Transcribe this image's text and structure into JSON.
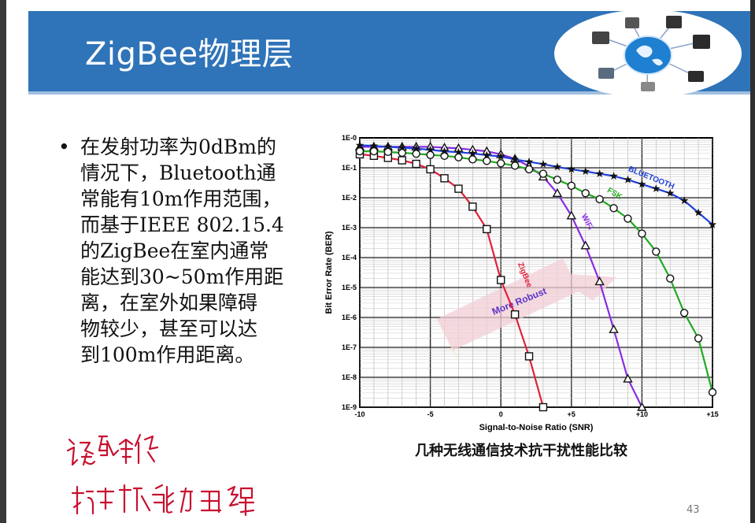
{
  "slide": {
    "title": "ZigBee物理层",
    "bullet_marker": "•",
    "bullet_text": "在发射功率为0dBm的\n情况下，Bluetooth通\n常能有10m作用范围，\n而基于IEEE 802.15.4\n的ZigBee在室内通常\n能达到30~50m作用距\n离，在室外如果障碍\n物较少，甚至可以达\n到100m作用距离。",
    "caption": "几种无线通信技术抗干扰性能比较",
    "page_number": "43",
    "logo_icon": "network-globe-icon",
    "handwriting_icon": "handwritten-annotation-icon",
    "colors": {
      "banner": "#2f73b8",
      "zigbee": "#e0203a",
      "wifi": "#8a2be2",
      "fsk": "#22aa22",
      "bluetooth": "#1f3fd8"
    }
  },
  "chart_data": {
    "type": "line",
    "xlabel": "Signal-to-Noise Ratio (SNR)",
    "ylabel": "Bit Error Rate (BER)",
    "xlim": [
      -10,
      15
    ],
    "ylim_log10": [
      -9,
      0
    ],
    "x_ticks": [
      "-10",
      "-5",
      "0",
      "+5",
      "+10",
      "+15"
    ],
    "x_tick_values": [
      -10,
      -5,
      0,
      5,
      10,
      15
    ],
    "y_ticks": [
      "1E-0",
      "1E-1",
      "1E-2",
      "1E-3",
      "1E-4",
      "1E-5",
      "1E-6",
      "1E-7",
      "1E-8",
      "1E-9"
    ],
    "y_tick_exponents": [
      0,
      -1,
      -2,
      -3,
      -4,
      -5,
      -6,
      -7,
      -8,
      -9
    ],
    "grid": true,
    "arrow_label": "More Robust",
    "series": [
      {
        "name": "ZigBee",
        "marker": "square",
        "color": "#e0203a",
        "points": [
          [
            -10,
            -0.55
          ],
          [
            -9,
            -0.6
          ],
          [
            -8,
            -0.67
          ],
          [
            -7,
            -0.75
          ],
          [
            -6,
            -0.87
          ],
          [
            -5,
            -1.05
          ],
          [
            -4,
            -1.35
          ],
          [
            -3,
            -1.7
          ],
          [
            -2,
            -2.3
          ],
          [
            -1,
            -3.05
          ],
          [
            0,
            -4.75
          ],
          [
            1,
            -5.9
          ],
          [
            2,
            -7.3
          ],
          [
            3,
            -9.0
          ]
        ]
      },
      {
        "name": "WiFi",
        "marker": "triangle",
        "color": "#8a2be2",
        "points": [
          [
            -10,
            -0.3
          ],
          [
            -9,
            -0.3
          ],
          [
            -8,
            -0.3
          ],
          [
            -7,
            -0.3
          ],
          [
            -6,
            -0.3
          ],
          [
            -5,
            -0.3
          ],
          [
            -4,
            -0.33
          ],
          [
            -3,
            -0.35
          ],
          [
            -2,
            -0.4
          ],
          [
            -1,
            -0.45
          ],
          [
            0,
            -0.55
          ],
          [
            1,
            -0.7
          ],
          [
            2,
            -0.95
          ],
          [
            3,
            -1.3
          ],
          [
            4,
            -1.85
          ],
          [
            5,
            -2.6
          ],
          [
            6,
            -3.6
          ],
          [
            7,
            -4.8
          ],
          [
            8,
            -6.4
          ],
          [
            9,
            -8.05
          ],
          [
            10,
            -9.0
          ]
        ]
      },
      {
        "name": "FSK",
        "marker": "circle",
        "color": "#22aa22",
        "points": [
          [
            -10,
            -0.45
          ],
          [
            -9,
            -0.45
          ],
          [
            -8,
            -0.47
          ],
          [
            -7,
            -0.5
          ],
          [
            -6,
            -0.53
          ],
          [
            -5,
            -0.57
          ],
          [
            -4,
            -0.6
          ],
          [
            -3,
            -0.65
          ],
          [
            -2,
            -0.72
          ],
          [
            -1,
            -0.77
          ],
          [
            0,
            -0.85
          ],
          [
            1,
            -0.93
          ],
          [
            2,
            -1.05
          ],
          [
            3,
            -1.2
          ],
          [
            4,
            -1.4
          ],
          [
            5,
            -1.6
          ],
          [
            6,
            -1.85
          ],
          [
            7,
            -2.05
          ],
          [
            8,
            -2.35
          ],
          [
            9,
            -2.7
          ],
          [
            10,
            -3.2
          ],
          [
            11,
            -3.8
          ],
          [
            12,
            -4.7
          ],
          [
            13,
            -5.85
          ],
          [
            14,
            -6.7
          ],
          [
            15,
            -8.5
          ]
        ]
      },
      {
        "name": "BLUETOOTH",
        "marker": "star",
        "color": "#1f3fd8",
        "points": [
          [
            -10,
            -0.25
          ],
          [
            -9,
            -0.27
          ],
          [
            -8,
            -0.3
          ],
          [
            -7,
            -0.33
          ],
          [
            -6,
            -0.36
          ],
          [
            -5,
            -0.4
          ],
          [
            -4,
            -0.45
          ],
          [
            -3,
            -0.48
          ],
          [
            -2,
            -0.52
          ],
          [
            -1,
            -0.58
          ],
          [
            0,
            -0.62
          ],
          [
            1,
            -0.72
          ],
          [
            2,
            -0.8
          ],
          [
            3,
            -0.88
          ],
          [
            4,
            -0.97
          ],
          [
            5,
            -1.05
          ],
          [
            6,
            -1.12
          ],
          [
            7,
            -1.2
          ],
          [
            8,
            -1.28
          ],
          [
            9,
            -1.4
          ],
          [
            10,
            -1.55
          ],
          [
            11,
            -1.7
          ],
          [
            12,
            -1.85
          ],
          [
            13,
            -2.1
          ],
          [
            14,
            -2.5
          ],
          [
            15,
            -2.9
          ]
        ]
      }
    ]
  }
}
